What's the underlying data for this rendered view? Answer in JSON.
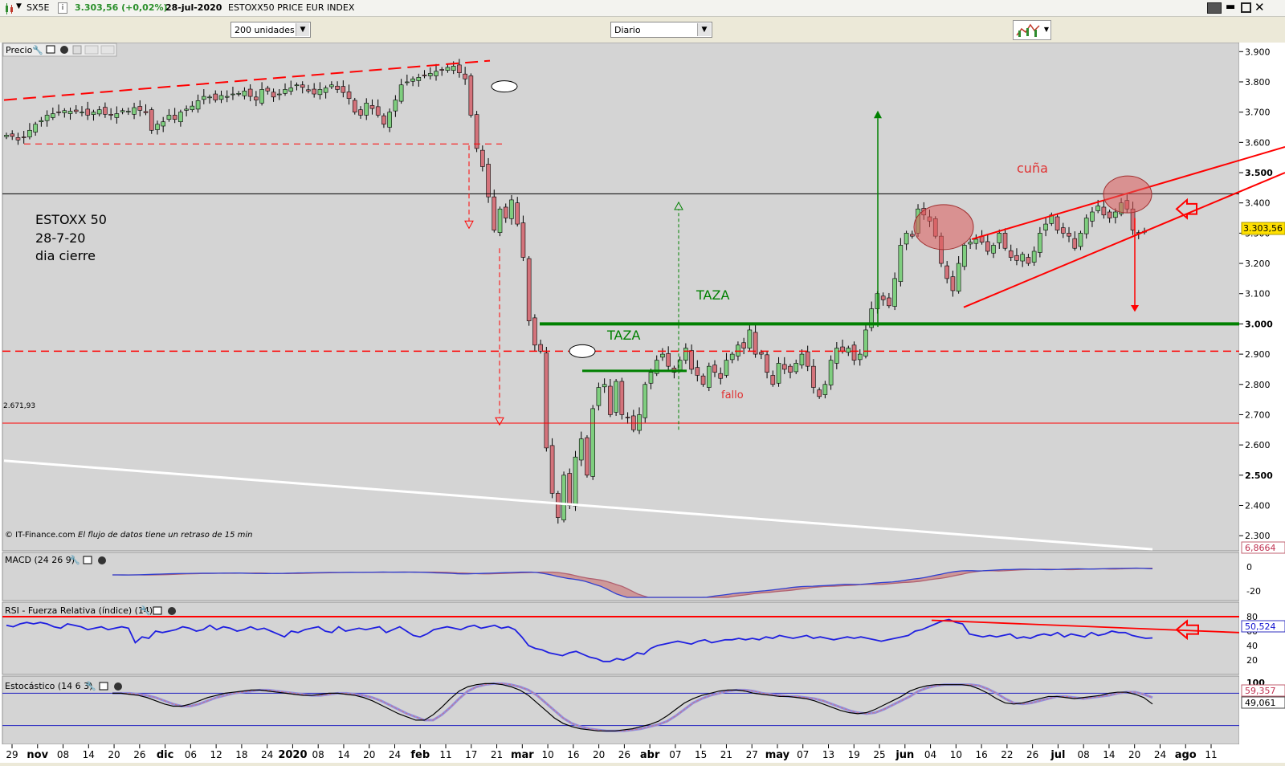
{
  "window": {
    "symbol": "SX5E",
    "price": "3.303,56 (+0,02%)",
    "date": "28-jul-2020",
    "instrument": "ESTOXX50 PRICE EUR INDEX"
  },
  "toolbar": {
    "units_select": "200 unidades",
    "period_select": "Diario"
  },
  "panels": {
    "price_title": "Precio",
    "macd_title": "MACD (24 26 9)",
    "rsi_title": "RSI - Fuerza Relativa (índice) (14)",
    "stoch_title": "Estocástico (14 6 3)",
    "copyright": "© IT-Finance.com",
    "delay_note": "El flujo de datos tiene un retraso de 15 min"
  },
  "annotations": {
    "label_line1": "ESTOXX 50",
    "label_line2": "28-7-20",
    "label_line3": "dia cierre",
    "taza_upper": "TAZA",
    "taza_lower": "TAZA",
    "fallo": "fallo",
    "cuna": "cuña",
    "level_2671": "2.671,93"
  },
  "value_tags": {
    "price": "3.303,56",
    "macd": "6,8664",
    "rsi": "50,524",
    "stoch_k": "59,357",
    "stoch_d": "49,061"
  },
  "colors": {
    "up_candle": "#7fce7f",
    "down_candle": "#d4737b",
    "trend_red": "#ff0000",
    "taza_green": "#008000",
    "resistance_black": "#000000",
    "support_white": "#ffffff",
    "panel_bg": "#d4d4d4"
  },
  "chart_data": [
    {
      "type": "candlestick",
      "title": "Precio",
      "x_tick_labels": [
        "29",
        "nov",
        "08",
        "14",
        "20",
        "26",
        "dic",
        "06",
        "12",
        "18",
        "24",
        "2020",
        "08",
        "14",
        "20",
        "24",
        "feb",
        "11",
        "17",
        "21",
        "mar",
        "10",
        "16",
        "20",
        "26",
        "abr",
        "07",
        "15",
        "21",
        "27",
        "may",
        "07",
        "13",
        "19",
        "25",
        "jun",
        "04",
        "10",
        "16",
        "22",
        "26",
        "jul",
        "08",
        "14",
        "20",
        "24",
        "ago",
        "11"
      ],
      "y_tick_labels": [
        "3.900",
        "3.800",
        "3.700",
        "3.600",
        "3.500",
        "3.400",
        "3.300",
        "3.200",
        "3.100",
        "3.000",
        "2.900",
        "2.800",
        "2.700",
        "2.600",
        "2.500",
        "2.400",
        "2.300"
      ],
      "ylim": [
        2250,
        3930
      ],
      "last_close": 3303.56,
      "horizontal_levels": [
        3430,
        3000,
        2910,
        2671.93,
        2845,
        3595
      ],
      "closes": [
        3624,
        3620,
        3608,
        3616,
        3640,
        3660,
        3672,
        3690,
        3695,
        3700,
        3705,
        3703,
        3702,
        3700,
        3690,
        3700,
        3708,
        3693,
        3690,
        3695,
        3705,
        3703,
        3715,
        3706,
        3698,
        3640,
        3660,
        3668,
        3690,
        3676,
        3700,
        3710,
        3720,
        3738,
        3752,
        3750,
        3740,
        3755,
        3752,
        3760,
        3762,
        3770,
        3752,
        3740,
        3775,
        3770,
        3750,
        3760,
        3775,
        3780,
        3790,
        3782,
        3770,
        3760,
        3775,
        3780,
        3790,
        3775,
        3765,
        3745,
        3700,
        3690,
        3730,
        3712,
        3690,
        3660,
        3700,
        3740,
        3790,
        3800,
        3810,
        3815,
        3820,
        3828,
        3835,
        3840,
        3848,
        3852,
        3830,
        3810,
        3690,
        3580,
        3520,
        3420,
        3310,
        3380,
        3350,
        3410,
        3330,
        3220,
        3010,
        2930,
        2910,
        2590,
        2440,
        2360,
        2500,
        2400,
        2560,
        2620,
        2500,
        2720,
        2790,
        2800,
        2700,
        2810,
        2700,
        2690,
        2650,
        2700,
        2800,
        2840,
        2880,
        2900,
        2860,
        2840,
        2880,
        2920,
        2850,
        2830,
        2800,
        2860,
        2840,
        2820,
        2880,
        2900,
        2930,
        2920,
        2980,
        2900,
        2900,
        2840,
        2800,
        2870,
        2850,
        2840,
        2870,
        2900,
        2860,
        2790,
        2760,
        2800,
        2880,
        2920,
        2910,
        2920,
        2880,
        2900,
        2980,
        3050,
        3100,
        3080,
        3060,
        3150,
        3260,
        3300,
        3290,
        3380,
        3360,
        3340,
        3290,
        3200,
        3150,
        3110,
        3200,
        3260,
        3270,
        3280,
        3270,
        3240,
        3260,
        3300,
        3250,
        3220,
        3210,
        3230,
        3200,
        3240,
        3300,
        3330,
        3360,
        3310,
        3300,
        3290,
        3250,
        3300,
        3350,
        3370,
        3390,
        3360,
        3350,
        3370,
        3400,
        3380,
        3310,
        3300,
        3303.56
      ]
    },
    {
      "type": "line",
      "title": "MACD (24 26 9)",
      "y_tick_labels": [
        "0",
        "-20"
      ],
      "last_value": 6.8664
    },
    {
      "type": "line",
      "title": "RSI - Fuerza Relativa (índice) (14)",
      "y_tick_labels": [
        "80",
        "60",
        "40",
        "20"
      ],
      "ylim": [
        0,
        100
      ],
      "last_value": 50.524,
      "horizontal_levels": [
        80
      ],
      "values": [
        68,
        66,
        70,
        72,
        70,
        72,
        70,
        66,
        64,
        70,
        68,
        66,
        62,
        64,
        66,
        62,
        64,
        66,
        64,
        44,
        52,
        50,
        60,
        58,
        60,
        62,
        66,
        64,
        60,
        62,
        68,
        62,
        66,
        64,
        60,
        62,
        66,
        62,
        64,
        60,
        56,
        52,
        60,
        58,
        62,
        64,
        66,
        60,
        58,
        66,
        60,
        62,
        64,
        62,
        64,
        66,
        58,
        62,
        66,
        60,
        54,
        52,
        56,
        62,
        64,
        66,
        64,
        62,
        66,
        68,
        64,
        66,
        68,
        64,
        66,
        62,
        52,
        40,
        36,
        34,
        30,
        28,
        26,
        30,
        32,
        28,
        24,
        22,
        18,
        18,
        22,
        20,
        24,
        30,
        28,
        36,
        40,
        42,
        44,
        46,
        44,
        42,
        46,
        48,
        44,
        46,
        48,
        48,
        50,
        48,
        50,
        48,
        52,
        50,
        54,
        52,
        50,
        52,
        54,
        50,
        52,
        50,
        48,
        50,
        52,
        50,
        52,
        50,
        48,
        46,
        48,
        50,
        52,
        54,
        60,
        62,
        66,
        70,
        74,
        76,
        72,
        70,
        56,
        54,
        52,
        54,
        52,
        54,
        56,
        50,
        52,
        50,
        54,
        56,
        54,
        58,
        52,
        56,
        54,
        52,
        58,
        54,
        56,
        60,
        58,
        58,
        54,
        52,
        50,
        50.524
      ]
    },
    {
      "type": "line",
      "title": "Estocástico (14 6 3)",
      "y_tick_labels": [
        "100"
      ],
      "ylim": [
        0,
        100
      ],
      "last_k": 59.357,
      "last_d": 49.061,
      "horizontal_levels": [
        80,
        20
      ],
      "values": [
        80,
        80,
        78,
        76,
        72,
        66,
        60,
        56,
        56,
        60,
        66,
        72,
        76,
        80,
        82,
        84,
        86,
        86,
        84,
        82,
        80,
        78,
        76,
        76,
        78,
        80,
        80,
        78,
        76,
        72,
        66,
        58,
        50,
        42,
        36,
        30,
        30,
        40,
        54,
        70,
        84,
        92,
        96,
        98,
        98,
        96,
        92,
        86,
        76,
        62,
        48,
        34,
        24,
        18,
        14,
        12,
        10,
        10,
        10,
        12,
        14,
        18,
        22,
        28,
        38,
        50,
        62,
        70,
        76,
        80,
        84,
        86,
        86,
        84,
        80,
        78,
        76,
        74,
        74,
        72,
        70,
        66,
        60,
        54,
        48,
        44,
        42,
        44,
        50,
        58,
        66,
        74,
        84,
        90,
        94,
        96,
        96,
        96,
        96,
        94,
        88,
        80,
        70,
        62,
        60,
        62,
        66,
        70,
        74,
        74,
        72,
        70,
        72,
        74,
        76,
        80,
        82,
        82,
        78,
        72,
        60
      ]
    }
  ]
}
